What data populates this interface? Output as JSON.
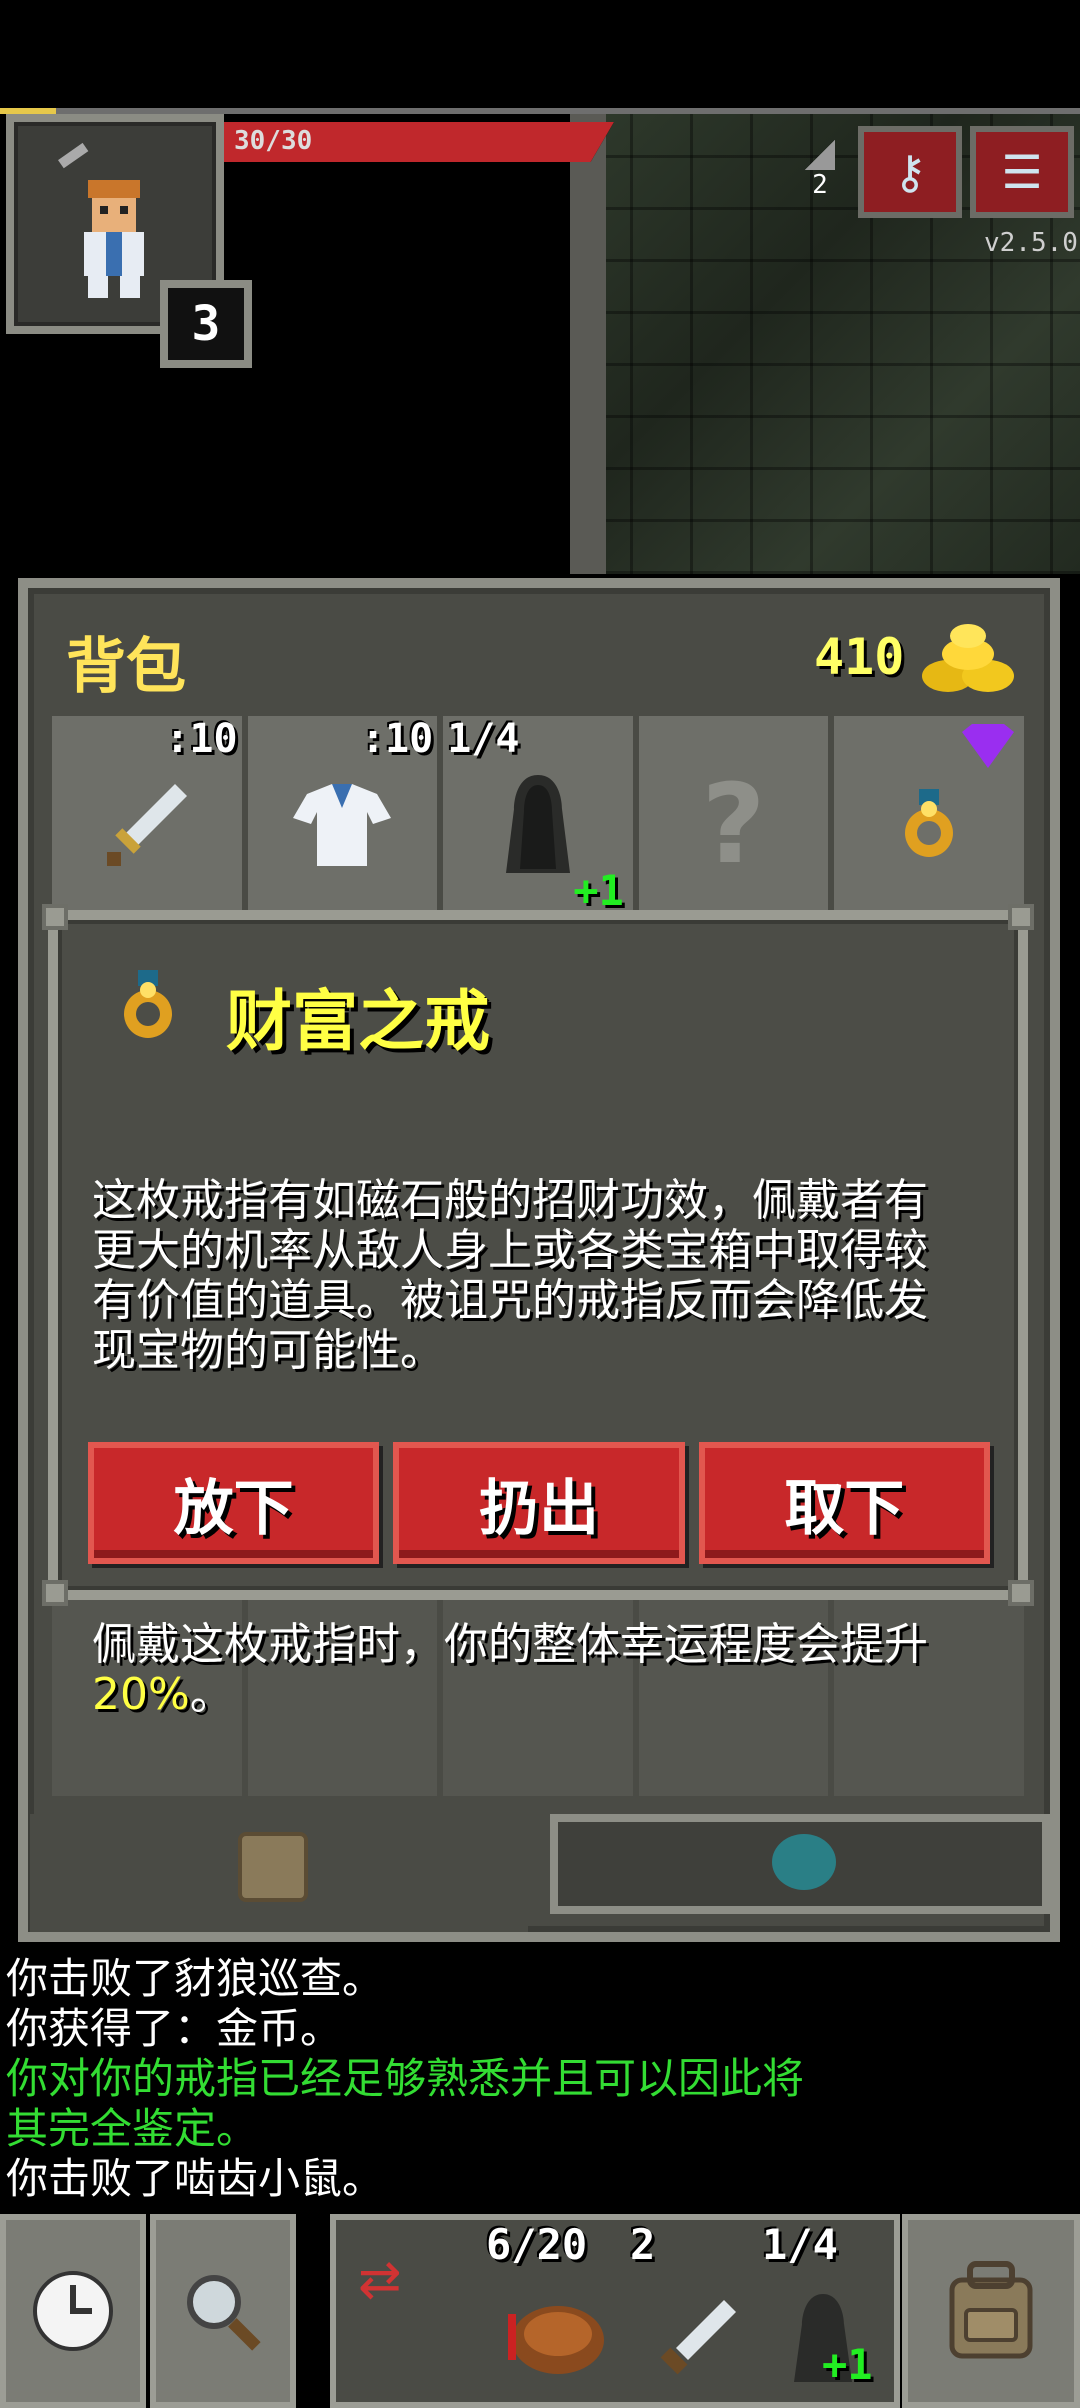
{
  "hud": {
    "hp_text": "30/30",
    "hp_fraction": 1.0,
    "level": "3",
    "depth": "2",
    "version": "v2.5.0",
    "journal_icon": "key-icon",
    "menu_icon": "menu-icon"
  },
  "backpack": {
    "title": "背包",
    "gold": "410",
    "slots": [
      {
        "count": ":10",
        "icon": "sword-icon",
        "glyph": "🗡"
      },
      {
        "count": ":10",
        "icon": "cloth-armor-icon",
        "glyph": "👕"
      },
      {
        "count": "1/4",
        "icon": "cloak-icon",
        "glyph": "",
        "plus": "+1"
      },
      {
        "count": "",
        "icon": "empty-slot-question-icon",
        "glyph": "?"
      },
      {
        "count": "",
        "icon": "ring-icon",
        "glyph": "💍"
      }
    ]
  },
  "item": {
    "name": "财富之戒",
    "description_1": "这枚戒指有如磁石般的招财功效，佩戴者有\n更大的机率从敌人身上或各类宝箱中取得较\n有价值的道具。被诅咒的戒指反而会降低发\n现宝物的可能性。",
    "description_2": "佩戴这枚戒指时，你的整体幸运程度会提升",
    "highlight": "20%",
    "end_punct": "。",
    "buttons": {
      "drop": "放下",
      "throw": "扔出",
      "unequip": "取下"
    }
  },
  "log": [
    {
      "text": "你击败了豺狼巡查。",
      "color": "#ffffff"
    },
    {
      "text": "你获得了：金币。",
      "color": "#ffffff"
    },
    {
      "text": "你对你的戒指已经足够熟悉并且可以因此将\n其完全鉴定。",
      "color": "#33dd33"
    },
    {
      "text": "你击败了啮齿小鼠。",
      "color": "#ffffff"
    }
  ],
  "toolbar": {
    "quickslot_food_count": "6/20",
    "quickslot_dagger_count": "2",
    "quickslot_cloak_count": "1/4",
    "quickslot_cloak_plus": "+1"
  },
  "colors": {
    "accent_yellow": "#ffff44",
    "button_red": "#c8282a",
    "log_green": "#33dd33",
    "panel": "#4a4b45"
  }
}
